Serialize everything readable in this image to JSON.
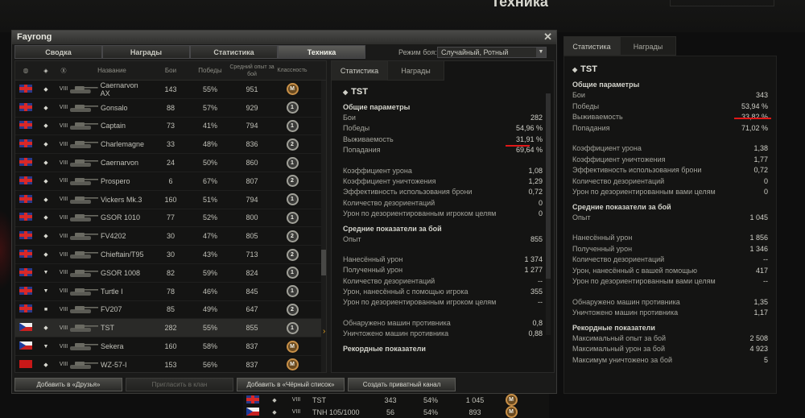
{
  "background": {
    "title": "Техника"
  },
  "window": {
    "title": "Fayrong",
    "tabs": [
      {
        "label": "Сводка",
        "active": false
      },
      {
        "label": "Награды",
        "active": false
      },
      {
        "label": "Статистика",
        "active": false
      },
      {
        "label": "Техника",
        "active": true
      }
    ],
    "mode_label": "Режим боя:",
    "mode_value": "Случайный, Ротный"
  },
  "list": {
    "headers": {
      "name": "Название",
      "battles": "Бои",
      "wins": "Победы",
      "xp": "Средний опыт за бой",
      "class": "Классность"
    },
    "rows": [
      {
        "flag": "uk",
        "type": "◆",
        "tier": "VIII",
        "name": "Caernarvon AX",
        "battles": "143",
        "wins": "55%",
        "xp": "951",
        "badge": "M",
        "badge_kind": "m"
      },
      {
        "flag": "uk",
        "type": "◆",
        "tier": "VIII",
        "name": "Gonsalo",
        "battles": "88",
        "wins": "57%",
        "xp": "929",
        "badge": "1",
        "badge_kind": "n"
      },
      {
        "flag": "uk",
        "type": "◆",
        "tier": "VIII",
        "name": "Captain",
        "battles": "73",
        "wins": "41%",
        "xp": "794",
        "badge": "1",
        "badge_kind": "n"
      },
      {
        "flag": "uk",
        "type": "◆",
        "tier": "VIII",
        "name": "Charlemagne",
        "battles": "33",
        "wins": "48%",
        "xp": "836",
        "badge": "2",
        "badge_kind": "n"
      },
      {
        "flag": "uk",
        "type": "◆",
        "tier": "VIII",
        "name": "Caernarvon",
        "battles": "24",
        "wins": "50%",
        "xp": "860",
        "badge": "1",
        "badge_kind": "n"
      },
      {
        "flag": "uk",
        "type": "◆",
        "tier": "VIII",
        "name": "Prospero",
        "battles": "6",
        "wins": "67%",
        "xp": "807",
        "badge": "2",
        "badge_kind": "n"
      },
      {
        "flag": "uk",
        "type": "◆",
        "tier": "VIII",
        "name": "Vickers Mk.3",
        "battles": "160",
        "wins": "51%",
        "xp": "794",
        "badge": "1",
        "badge_kind": "n"
      },
      {
        "flag": "uk",
        "type": "◆",
        "tier": "VIII",
        "name": "GSOR 1010",
        "battles": "77",
        "wins": "52%",
        "xp": "800",
        "badge": "1",
        "badge_kind": "n"
      },
      {
        "flag": "uk",
        "type": "◆",
        "tier": "VIII",
        "name": "FV4202",
        "battles": "30",
        "wins": "47%",
        "xp": "805",
        "badge": "2",
        "badge_kind": "n"
      },
      {
        "flag": "uk",
        "type": "◆",
        "tier": "VIII",
        "name": "Chieftain/T95",
        "battles": "30",
        "wins": "43%",
        "xp": "713",
        "badge": "2",
        "badge_kind": "n"
      },
      {
        "flag": "uk",
        "type": "▼",
        "tier": "VIII",
        "name": "GSOR 1008",
        "battles": "82",
        "wins": "59%",
        "xp": "824",
        "badge": "1",
        "badge_kind": "n"
      },
      {
        "flag": "uk",
        "type": "▼",
        "tier": "VIII",
        "name": "Turtle I",
        "battles": "78",
        "wins": "46%",
        "xp": "845",
        "badge": "1",
        "badge_kind": "n"
      },
      {
        "flag": "uk",
        "type": "■",
        "tier": "VIII",
        "name": "FV207",
        "battles": "85",
        "wins": "49%",
        "xp": "647",
        "badge": "2",
        "badge_kind": "n"
      },
      {
        "flag": "cz",
        "type": "◆",
        "tier": "VIII",
        "name": "TST",
        "battles": "282",
        "wins": "55%",
        "xp": "855",
        "badge": "1",
        "badge_kind": "n",
        "selected": true
      },
      {
        "flag": "cz",
        "type": "▼",
        "tier": "VIII",
        "name": "Sekera",
        "battles": "160",
        "wins": "58%",
        "xp": "837",
        "badge": "M",
        "badge_kind": "m"
      },
      {
        "flag": "cn",
        "type": "◆",
        "tier": "VIII",
        "name": "WZ-57-I",
        "battles": "153",
        "wins": "56%",
        "xp": "837",
        "badge": "M",
        "badge_kind": "m"
      }
    ]
  },
  "stats": {
    "tabs": [
      "Статистика",
      "Награды"
    ],
    "vehicle": "TST",
    "general_title": "Общие параметры",
    "general": [
      {
        "label": "Бои",
        "value": "282"
      },
      {
        "label": "Победы",
        "value": "54,96 %"
      },
      {
        "label": "Выживаемость",
        "value": "31,91 %"
      },
      {
        "label": "Попадания",
        "value": "69,64 %"
      }
    ],
    "coef": [
      {
        "label": "Коэффициент урона",
        "value": "1,08"
      },
      {
        "label": "Коэффициент уничтожения",
        "value": "1,29"
      },
      {
        "label": "Эффективность использования брони",
        "value": "0,72"
      },
      {
        "label": "Количество дезориентаций",
        "value": "0"
      },
      {
        "label": "Урон по дезориентированным игроком целям",
        "value": "0"
      }
    ],
    "avg_title": "Средние показатели за бой",
    "avg": [
      {
        "label": "Опыт",
        "value": "855"
      }
    ],
    "avg2": [
      {
        "label": "Нанесённый урон",
        "value": "1 374"
      },
      {
        "label": "Полученный урон",
        "value": "1 277"
      },
      {
        "label": "Количество дезориентаций",
        "value": "--"
      },
      {
        "label": "Урон, нанесённый с помощью игрока",
        "value": "355"
      },
      {
        "label": "Урон по дезориентированным игроком целям",
        "value": "--"
      }
    ],
    "avg3": [
      {
        "label": "Обнаружено машин противника",
        "value": "0,8"
      },
      {
        "label": "Уничтожено машин противника",
        "value": "0,88"
      }
    ],
    "record_title": "Рекордные показатели"
  },
  "buttons": {
    "add_friends": "Добавить в «Друзья»",
    "invite_clan": "Пригласить в клан",
    "add_blacklist": "Добавить в «Чёрный список»",
    "create_channel": "Создать приватный канал"
  },
  "right_panel": {
    "tabs": [
      "Статистика",
      "Награды"
    ],
    "vehicle": "TST",
    "general_title": "Общие параметры",
    "general": [
      {
        "label": "Бои",
        "value": "343"
      },
      {
        "label": "Победы",
        "value": "53,94 %"
      },
      {
        "label": "Выживаемость",
        "value": "33,82 %"
      },
      {
        "label": "Попадания",
        "value": "71,02 %"
      }
    ],
    "coef": [
      {
        "label": "Коэффициент урона",
        "value": "1,38"
      },
      {
        "label": "Коэффициент уничтожения",
        "value": "1,77"
      },
      {
        "label": "Эффективность использования брони",
        "value": "0,72"
      },
      {
        "label": "Количество дезориентаций",
        "value": "0"
      },
      {
        "label": "Урон по дезориентированным вами целям",
        "value": "0"
      }
    ],
    "avg_title": "Средние показатели за бой",
    "avg": [
      {
        "label": "Опыт",
        "value": "1 045"
      }
    ],
    "avg2": [
      {
        "label": "Нанесённый урон",
        "value": "1 856"
      },
      {
        "label": "Полученный урон",
        "value": "1 346"
      },
      {
        "label": "Количество дезориентаций",
        "value": "--"
      },
      {
        "label": "Урон, нанесённый с вашей помощью",
        "value": "417"
      },
      {
        "label": "Урон по дезориентированным вами целям",
        "value": "--"
      }
    ],
    "avg3": [
      {
        "label": "Обнаружено машин противника",
        "value": "1,35"
      },
      {
        "label": "Уничтожено машин противника",
        "value": "1,17"
      }
    ],
    "record_title": "Рекордные показатели",
    "records": [
      {
        "label": "Максимальный опыт за бой",
        "value": "2 508"
      },
      {
        "label": "Максимальный урон за бой",
        "value": "4 923"
      },
      {
        "label": "Максимум уничтожено за бой",
        "value": "5"
      }
    ]
  },
  "peek": [
    {
      "flag": "uk",
      "tier": "VIII",
      "name": "TST",
      "battles": "343",
      "wins": "54%",
      "xp": "1 045",
      "badge": "M"
    },
    {
      "flag": "cz",
      "tier": "VIII",
      "name": "TNH 105/1000",
      "battles": "56",
      "wins": "54%",
      "xp": "893",
      "badge": "M"
    }
  ],
  "colors": {
    "highlight_underline": "#e01818",
    "selected_arrow": "#e0a020"
  }
}
